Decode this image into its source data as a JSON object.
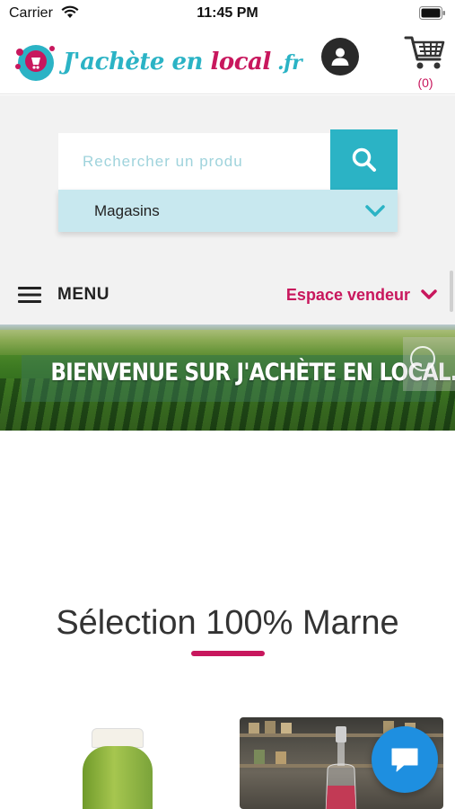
{
  "status_bar": {
    "carrier": "Carrier",
    "time": "11:45 PM"
  },
  "header": {
    "logo_text_part1": "J'achète en ",
    "logo_text_part2": "local",
    "logo_text_part3": " .fr",
    "account_icon": "user-circle-icon",
    "cart_icon": "shopping-cart-icon",
    "cart_count": "(0)"
  },
  "search": {
    "placeholder": "Rechercher un produ",
    "button_icon": "search-icon",
    "scope_label": "Magasins",
    "scope_icon": "chevron-down-icon"
  },
  "menu": {
    "label": "MENU",
    "seller_label": "Espace vendeur"
  },
  "banner": {
    "title": "BIENVENUE SUR J'ACHÈTE EN LOCAL.FR"
  },
  "section": {
    "title": "Sélection 100% Marne"
  },
  "colors": {
    "accent_blue": "#2bb3c5",
    "accent_pink": "#c8175d",
    "chat_blue": "#1e8fe0"
  }
}
